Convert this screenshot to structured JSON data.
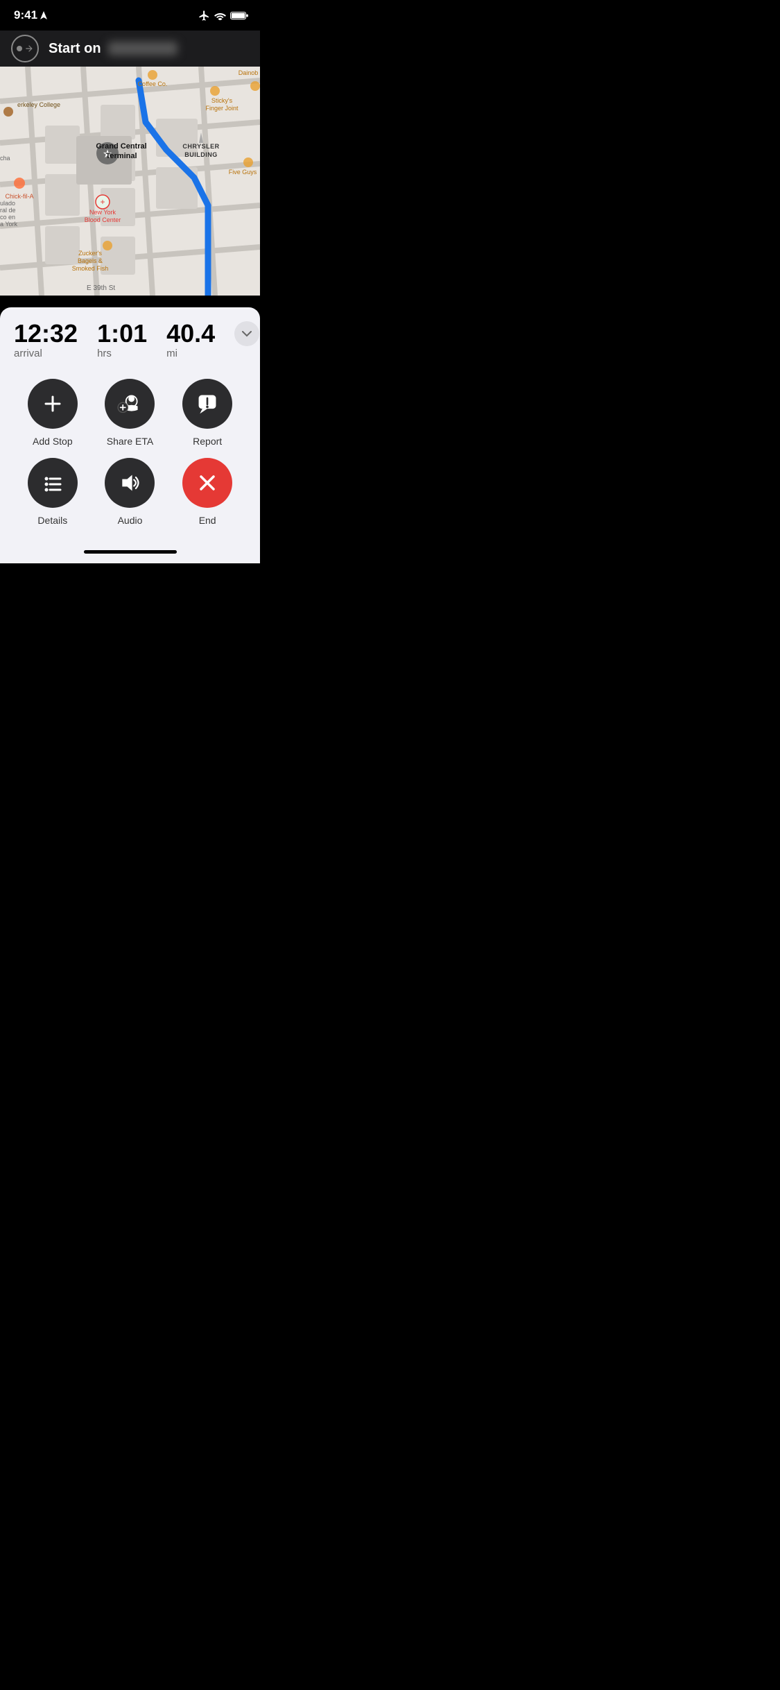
{
  "status_bar": {
    "time": "9:41",
    "airplane_mode": true,
    "wifi": true,
    "battery": "full"
  },
  "nav_bar": {
    "start_label": "Start on",
    "street_name": "████████ ██"
  },
  "map": {
    "places": [
      {
        "name": "Grand Central Terminal",
        "type": "landmark"
      },
      {
        "name": "Chrysler Building",
        "type": "landmark"
      },
      {
        "name": "New York Blood Center",
        "type": "medical"
      },
      {
        "name": "Chick-fil-A",
        "type": "restaurant"
      },
      {
        "name": "Sticky's Finger Joint",
        "type": "restaurant"
      },
      {
        "name": "Five Guys",
        "type": "restaurant"
      },
      {
        "name": "Zucker's Bagels & Smoked Fish",
        "type": "restaurant"
      },
      {
        "name": "Coffee Co.",
        "type": "cafe"
      },
      {
        "name": "Dainob",
        "type": "store"
      },
      {
        "name": "Berkeley College",
        "type": "college"
      },
      {
        "name": "E 39th St",
        "type": "street"
      }
    ],
    "route_color": "#1a73e8"
  },
  "eta": {
    "arrival_time": "12:32",
    "arrival_label": "arrival",
    "duration": "1:01",
    "duration_label": "hrs",
    "distance": "40.4",
    "distance_label": "mi"
  },
  "actions": [
    {
      "id": "add-stop",
      "label": "Add Stop",
      "icon": "plus",
      "color": "dark"
    },
    {
      "id": "share-eta",
      "label": "Share ETA",
      "icon": "share-eta",
      "color": "dark"
    },
    {
      "id": "report",
      "label": "Report",
      "icon": "report",
      "color": "dark"
    },
    {
      "id": "details",
      "label": "Details",
      "icon": "list",
      "color": "dark"
    },
    {
      "id": "audio",
      "label": "Audio",
      "icon": "audio",
      "color": "dark"
    },
    {
      "id": "end",
      "label": "End",
      "icon": "x",
      "color": "red"
    }
  ]
}
